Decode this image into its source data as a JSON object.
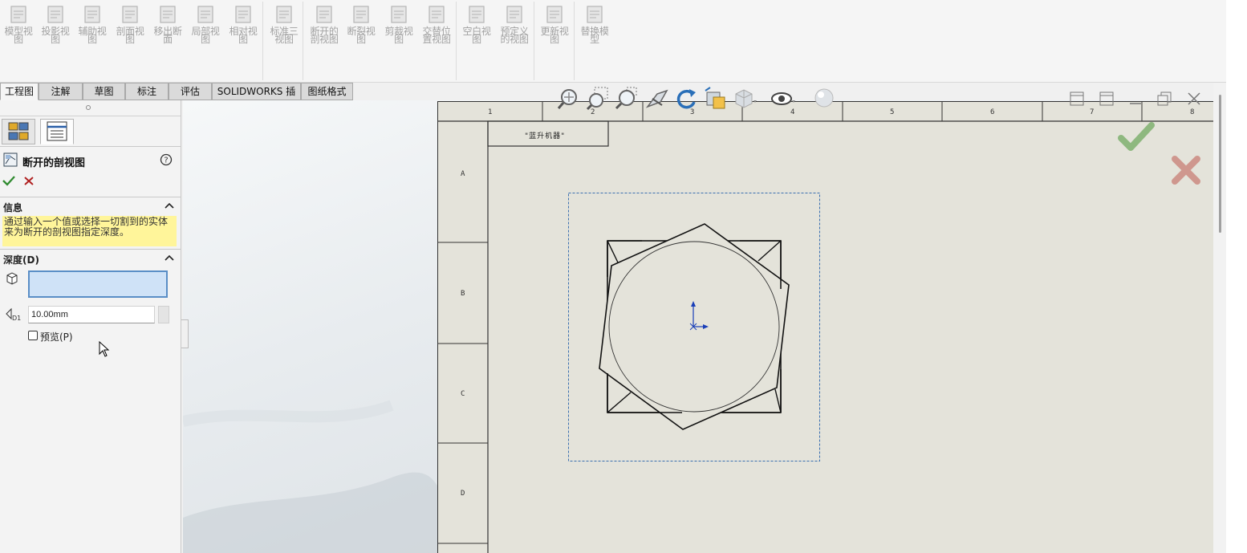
{
  "ribbon": {
    "buttons": [
      {
        "label": "模型视\n图",
        "icon": "model-view-icon"
      },
      {
        "label": "投影视\n图",
        "icon": "projected-view-icon"
      },
      {
        "label": "辅助视\n图",
        "icon": "auxiliary-view-icon"
      },
      {
        "label": "剖面视\n图",
        "icon": "section-view-icon"
      },
      {
        "label": "移出断\n面",
        "icon": "removed-section-icon"
      },
      {
        "label": "局部视\n图",
        "icon": "detail-view-icon"
      },
      {
        "label": "相对视\n图",
        "icon": "relative-view-icon"
      },
      {
        "label": "标准三\n视图",
        "icon": "standard-3-view-icon"
      },
      {
        "label": "断开的\n剖视图",
        "icon": "broken-out-section-icon"
      },
      {
        "label": "断裂视\n图",
        "icon": "break-view-icon"
      },
      {
        "label": "剪裁视\n图",
        "icon": "crop-view-icon"
      },
      {
        "label": "交替位\n置视图",
        "icon": "alternate-position-icon"
      },
      {
        "label": "空白视\n图",
        "icon": "empty-view-icon"
      },
      {
        "label": "预定义\n的视图",
        "icon": "predefined-view-icon"
      },
      {
        "label": "更新视\n图",
        "icon": "update-view-icon"
      },
      {
        "label": "替换模\n型",
        "icon": "replace-model-icon"
      }
    ]
  },
  "tabs": [
    "工程图",
    "注解",
    "草图",
    "标注",
    "评估",
    "SOLIDWORKS 插件",
    "图纸格式"
  ],
  "panel": {
    "title": "断开的剖视图",
    "info_header": "信息",
    "info_text": "通过输入一个值或选择一切割到的实体来为断开的剖视图指定深度。",
    "depth_header": "深度(D)",
    "depth_value": "10.00mm",
    "preview_label": "预览(P)"
  },
  "sheet": {
    "columns": [
      "1",
      "2",
      "3",
      "4",
      "5",
      "6",
      "7",
      "8"
    ],
    "rows": [
      "A",
      "B",
      "C",
      "D"
    ],
    "title_label": "\"蓝升机器\""
  },
  "colors": {
    "accept": "#7fb06e",
    "cancel": "#cd8f86",
    "info_bg": "#fff59a",
    "sheet_bg": "#e4e3da"
  }
}
